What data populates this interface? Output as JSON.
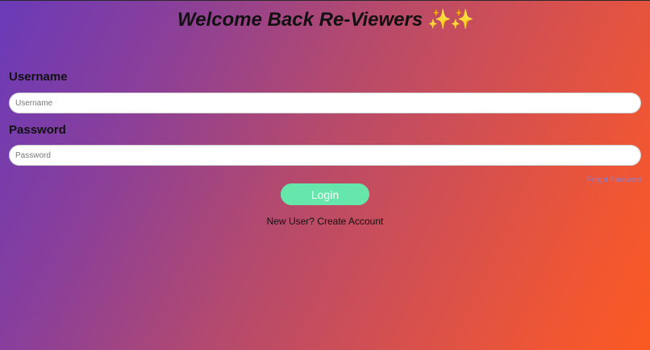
{
  "header": {
    "title": "Welcome Back Re-Viewers",
    "title_emoji": "✨✨"
  },
  "form": {
    "username_label": "Username",
    "username_placeholder": "Username",
    "password_label": "Password",
    "password_placeholder": "Password",
    "forgot_password": "Forgot Password",
    "login_button": "Login",
    "signup_prompt": "New User?",
    "signup_link": "Create Account"
  },
  "colors": {
    "gradient_start": "#6a3ab8",
    "gradient_end": "#fa5a22",
    "login_button": "#66e6ab",
    "forgot_link": "#8a7fd0"
  }
}
